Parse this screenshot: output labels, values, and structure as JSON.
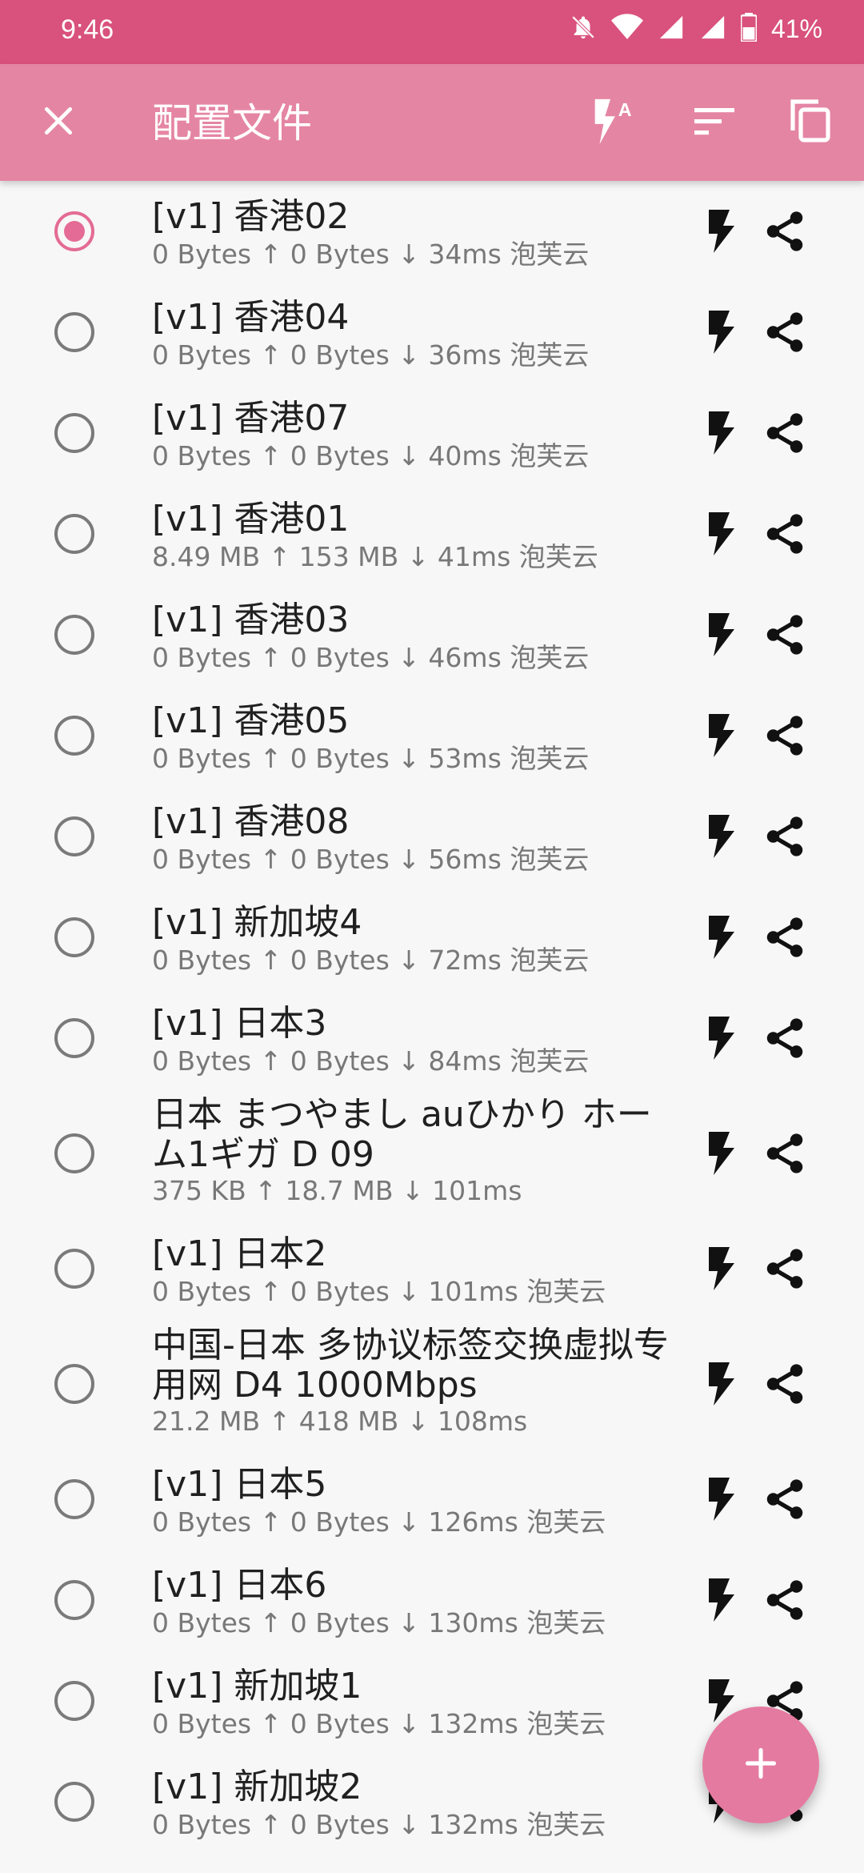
{
  "status_bar": {
    "time": "9:46",
    "battery": "41%"
  },
  "app_bar": {
    "title": "配置文件",
    "icons": [
      "close-icon",
      "auto-test-icon",
      "sort-icon",
      "copy-icon"
    ]
  },
  "profiles": [
    {
      "title": "[v1] 香港02",
      "sub": "0 Bytes ↑ 0 Bytes ↓ 34ms 泡芙云",
      "selected": true
    },
    {
      "title": "[v1] 香港04",
      "sub": "0 Bytes ↑ 0 Bytes ↓ 36ms 泡芙云"
    },
    {
      "title": "[v1] 香港07",
      "sub": "0 Bytes ↑ 0 Bytes ↓ 40ms 泡芙云"
    },
    {
      "title": "[v1] 香港01",
      "sub": "8.49 MB ↑ 153 MB ↓  41ms 泡芙云"
    },
    {
      "title": "[v1] 香港03",
      "sub": "0 Bytes ↑ 0 Bytes ↓ 46ms 泡芙云"
    },
    {
      "title": "[v1] 香港05",
      "sub": "0 Bytes ↑ 0 Bytes ↓ 53ms 泡芙云"
    },
    {
      "title": "[v1] 香港08",
      "sub": "0 Bytes ↑ 0 Bytes ↓ 56ms 泡芙云"
    },
    {
      "title": "[v1] 新加坡4",
      "sub": "0 Bytes ↑ 0 Bytes ↓ 72ms 泡芙云"
    },
    {
      "title": "[v1] 日本3",
      "sub": "0 Bytes ↑ 0 Bytes ↓ 84ms 泡芙云"
    },
    {
      "title": "日本 まつやまし auひかり ホーム1ギガ D 09",
      "sub": "375 KB ↑ 18.7 MB ↓ 101ms"
    },
    {
      "title": "[v1] 日本2",
      "sub": "0 Bytes ↑ 0 Bytes ↓ 101ms 泡芙云"
    },
    {
      "title": "中国-日本 多协议标签交换虚拟专用网 D4 1000Mbps",
      "sub": "21.2 MB ↑ 418 MB ↓  108ms"
    },
    {
      "title": "[v1] 日本5",
      "sub": "0 Bytes ↑ 0 Bytes ↓ 126ms 泡芙云"
    },
    {
      "title": "[v1] 日本6",
      "sub": "0 Bytes ↑ 0 Bytes ↓ 130ms 泡芙云"
    },
    {
      "title": "[v1] 新加坡1",
      "sub": "0 Bytes ↑ 0 Bytes ↓ 132ms 泡芙云"
    },
    {
      "title": "[v1] 新加坡2",
      "sub": "0 Bytes ↑ 0 Bytes ↓ 132ms 泡芙云"
    }
  ],
  "fab": {
    "icon": "plus-icon"
  },
  "colors": {
    "status_bar": "#d9517d",
    "app_bar": "#e585a4",
    "accent": "#e46b95"
  }
}
